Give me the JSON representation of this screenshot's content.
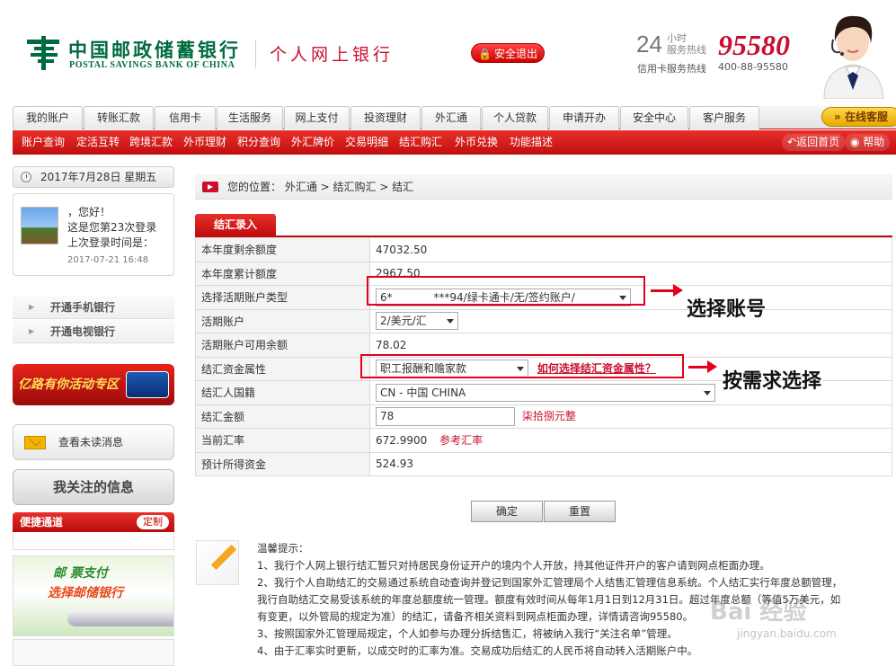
{
  "header": {
    "bank_name_cn": "中国邮政储蓄银行",
    "bank_name_en": "POSTAL SAVINGS BANK OF CHINA",
    "personal_title": "个人网上银行",
    "logout_label": "安全退出",
    "hotline_24": "24",
    "hotline_small_line1": "小时",
    "hotline_small_line2": "服务热线",
    "hotline_number": "95580",
    "credit_card_label": "信用卡服务热线",
    "credit_card_number": "400-88-95580"
  },
  "main_nav": {
    "tabs": [
      "我的账户",
      "转账汇款",
      "信用卡",
      "生活服务",
      "网上支付",
      "投资理财",
      "外汇通",
      "个人贷款",
      "申请开办",
      "安全中心",
      "客户服务"
    ],
    "online_service": "在线客服"
  },
  "sub_nav": {
    "items": [
      "账户查询",
      "定活互转",
      "跨境汇款",
      "外币理财",
      "积分查询",
      "外汇牌价",
      "交易明细",
      "结汇购汇",
      "外币兑换",
      "功能描述"
    ],
    "back_home": "返回首页",
    "help": "帮助"
  },
  "sidebar": {
    "date": "2017年7月28日  星期五",
    "greeting": "，您好！",
    "login_count": "这是您第23次登录",
    "last_login_label": "上次登录时间是：",
    "last_login_time": "2017-07-21 16:48",
    "links": [
      "开通手机银行",
      "开通电视银行"
    ],
    "promo": "亿路有你活动专区",
    "unread_messages": "查看未读消息",
    "my_follows": "我关注的信息",
    "quick_channel": "便捷通道",
    "customize": "定制",
    "banner_line1": "邮  票支付",
    "banner_line2": "选择邮储银行"
  },
  "breadcrumb": {
    "label": "您的位置：",
    "path": "外汇通 > 结汇购汇 > 结汇"
  },
  "form": {
    "tab_label": "结汇录入",
    "rows": {
      "remaining_quota_label": "本年度剩余额度",
      "remaining_quota_value": "47032.50",
      "used_quota_label": "本年度累计额度",
      "used_quota_value": "2967.50",
      "account_type_label": "选择活期账户类型",
      "account_type_value": "6*            ***94/绿卡通卡/无/签约账户/",
      "current_account_label": "活期账户",
      "current_account_value": "2/美元/汇",
      "balance_label": "活期账户可用余额",
      "balance_value": "78.02",
      "fund_attr_label": "结汇资金属性",
      "fund_attr_value": "职工报酬和赡家款",
      "fund_attr_help": "如何选择结汇资金属性？",
      "nationality_label": "结汇人国籍",
      "nationality_value": "CN - 中国 CHINA",
      "amount_label": "结汇金额",
      "amount_value": "78",
      "amount_words": "柒拾捌元整",
      "rate_label": "当前汇率",
      "rate_value": "672.9900",
      "rate_ref": "参考汇率",
      "expected_label": "预计所得资金",
      "expected_value": "524.93"
    },
    "confirm_label": "确定",
    "reset_label": "重置"
  },
  "annotations": {
    "select_account": "选择账号",
    "choose_as_needed": "按需求选择"
  },
  "tips": {
    "title": "温馨提示：",
    "lines": [
      "1、我行个人网上银行结汇暂只对持居民身份证开户的境内个人开放，持其他证件开户的客户请到网点柜面办理。",
      "2、我行个人自助结汇的交易通过系统自动查询并登记到国家外汇管理局个人结售汇管理信息系统。个人结汇实行年度总额管理，",
      "我行自助结汇交易受该系统的年度总额度统一管理。额度有效时间从每年1月1日到12月31日。超过年度总额（等值5万美元，如",
      "有变更，以外管局的规定为准）的结汇，请备齐相关资料到网点柜面办理，详情请咨询95580。",
      "3、按照国家外汇管理局规定，个人如参与办理分拆结售汇，将被纳入我行“关注名单”管理。",
      "4、由于汇率实时更新，以成交时的汇率为准。交易成功后结汇的人民币将自动转入活期账户中。"
    ]
  },
  "watermark": {
    "main": "Bai 经验",
    "url": "jingyan.baidu.com"
  },
  "colors": {
    "brand_red": "#c8102e",
    "brand_green": "#006b3f",
    "annotation_red": "#e3001b"
  }
}
